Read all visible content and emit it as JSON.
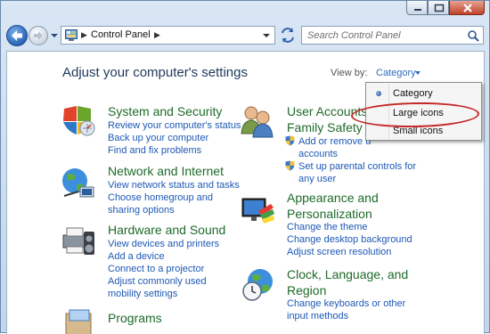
{
  "navigation": {
    "address": "Control Panel",
    "search_placeholder": "Search Control Panel"
  },
  "header": {
    "title": "Adjust your computer's settings",
    "view_by_label": "View by:",
    "view_by_value": "Category"
  },
  "view_menu": {
    "items": [
      {
        "label": "Category",
        "selected": true
      },
      {
        "label": "Large icons",
        "selected": false
      },
      {
        "label": "Small icons",
        "selected": false
      }
    ]
  },
  "categories": [
    {
      "title": "System and Security",
      "links": [
        "Review your computer's status",
        "Back up your computer",
        "Find and fix problems"
      ]
    },
    {
      "title": "Network and Internet",
      "links": [
        "View network status and tasks",
        "Choose homegroup and",
        "sharing options"
      ]
    },
    {
      "title": "Hardware and Sound",
      "links": [
        "View devices and printers",
        "Add a device",
        "Connect to a projector",
        "Adjust commonly used",
        "mobility settings"
      ]
    },
    {
      "title": "Programs",
      "links": []
    },
    {
      "title_lines": [
        "User Accounts",
        "Family Safety"
      ],
      "links": [
        "Add or remove u",
        "accounts",
        "Set up parental controls for",
        "any user"
      ]
    },
    {
      "title_lines": [
        "Appearance and",
        "Personalization"
      ],
      "links": [
        "Change the theme",
        "Change desktop background",
        "Adjust screen resolution"
      ]
    },
    {
      "title_lines": [
        "Clock, Language, and",
        "Region"
      ],
      "links": [
        "Change keyboards or other",
        "input methods"
      ]
    }
  ],
  "colors": {
    "category_title": "#1f6a2a",
    "link": "#1d59b5",
    "title": "#1e395b",
    "annotation": "#c62828"
  }
}
